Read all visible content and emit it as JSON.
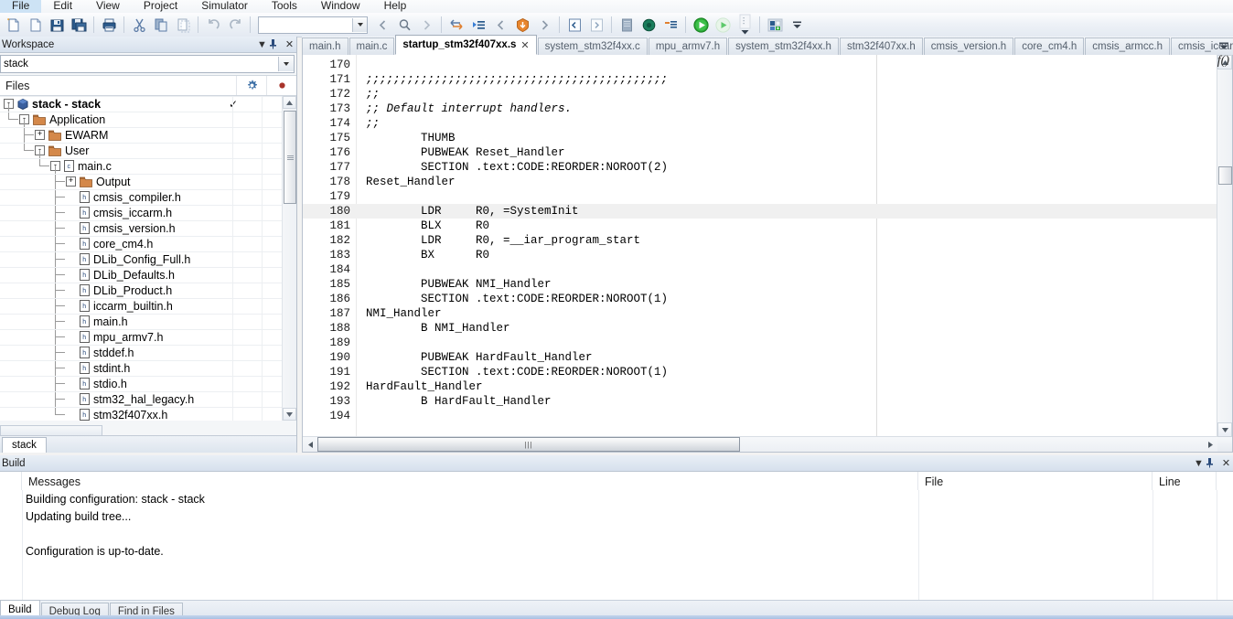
{
  "menu": {
    "items": [
      "File",
      "Edit",
      "View",
      "Project",
      "Simulator",
      "Tools",
      "Window",
      "Help"
    ]
  },
  "toolbar": {
    "buttons": [
      {
        "name": "new-document",
        "label": "New Document"
      },
      {
        "name": "open-file",
        "label": "Open File"
      },
      {
        "name": "save",
        "label": "Save"
      },
      {
        "name": "save-all",
        "label": "Save All"
      },
      {
        "name": "print",
        "label": "Print"
      },
      {
        "name": "cut",
        "label": "Cut"
      },
      {
        "name": "copy",
        "label": "Copy"
      },
      {
        "name": "paste",
        "label": "Paste"
      },
      {
        "name": "undo",
        "label": "Undo"
      },
      {
        "name": "redo",
        "label": "Redo"
      }
    ],
    "search_value": "",
    "search_placeholder": "",
    "nav_buttons": [
      {
        "name": "navigate-backward",
        "label": "Navigate Backward"
      },
      {
        "name": "quick-search",
        "label": "Quick Search"
      },
      {
        "name": "navigate-forward",
        "label": "Navigate Forward"
      },
      {
        "name": "toggle-bookmark",
        "label": "Toggle Bookmark"
      },
      {
        "name": "go-to-bookmark",
        "label": "Go To Bookmark"
      },
      {
        "name": "previous-bookmark",
        "label": "Previous Bookmark"
      },
      {
        "name": "compile",
        "label": "Compile"
      },
      {
        "name": "next-bookmark",
        "label": "Next Bookmark"
      },
      {
        "name": "step-into-source",
        "label": "Step Into"
      },
      {
        "name": "step-over-source",
        "label": "Step Over"
      },
      {
        "name": "make",
        "label": "Make"
      },
      {
        "name": "stop-build",
        "label": "Stop Build"
      },
      {
        "name": "toggle-breakpoint",
        "label": "Toggle Breakpoint"
      },
      {
        "name": "download-and-debug",
        "label": "Download and Debug"
      },
      {
        "name": "debug-without-download",
        "label": "Debug without Downloading"
      },
      {
        "name": "build-drop",
        "label": "Build Options"
      },
      {
        "name": "flash-programmer",
        "label": "Flash Programmer"
      }
    ]
  },
  "workspace": {
    "title": "Workspace",
    "controls": {
      "menu": "▼",
      "pin": "⌶",
      "close": "✕"
    },
    "config_value": "stack",
    "files_header": "Files",
    "gear_icon": "gear-icon",
    "dot_icon": "status-dot-icon",
    "bottom_tab": "stack",
    "tree": [
      {
        "label": "stack - stack",
        "depth": 0,
        "icon": "project-cube",
        "expander": "-",
        "bold": true,
        "check": "✓"
      },
      {
        "label": "Application",
        "depth": 1,
        "icon": "folder",
        "expander": "-",
        "bold": false,
        "check": ""
      },
      {
        "label": "EWARM",
        "depth": 2,
        "icon": "folder",
        "expander": "+",
        "bold": false,
        "check": ""
      },
      {
        "label": "User",
        "depth": 2,
        "icon": "folder",
        "expander": "-",
        "bold": false,
        "check": ""
      },
      {
        "label": "main.c",
        "depth": 3,
        "icon": "c-file",
        "expander": "-",
        "bold": false,
        "check": ""
      },
      {
        "label": "Output",
        "depth": 4,
        "icon": "folder",
        "expander": "+",
        "bold": false,
        "check": ""
      },
      {
        "label": "cmsis_compiler.h",
        "depth": 4,
        "icon": "h-file",
        "expander": "",
        "bold": false,
        "check": ""
      },
      {
        "label": "cmsis_iccarm.h",
        "depth": 4,
        "icon": "h-file",
        "expander": "",
        "bold": false,
        "check": ""
      },
      {
        "label": "cmsis_version.h",
        "depth": 4,
        "icon": "h-file",
        "expander": "",
        "bold": false,
        "check": ""
      },
      {
        "label": "core_cm4.h",
        "depth": 4,
        "icon": "h-file",
        "expander": "",
        "bold": false,
        "check": ""
      },
      {
        "label": "DLib_Config_Full.h",
        "depth": 4,
        "icon": "h-file",
        "expander": "",
        "bold": false,
        "check": ""
      },
      {
        "label": "DLib_Defaults.h",
        "depth": 4,
        "icon": "h-file",
        "expander": "",
        "bold": false,
        "check": ""
      },
      {
        "label": "DLib_Product.h",
        "depth": 4,
        "icon": "h-file",
        "expander": "",
        "bold": false,
        "check": ""
      },
      {
        "label": "iccarm_builtin.h",
        "depth": 4,
        "icon": "h-file",
        "expander": "",
        "bold": false,
        "check": ""
      },
      {
        "label": "main.h",
        "depth": 4,
        "icon": "h-file",
        "expander": "",
        "bold": false,
        "check": ""
      },
      {
        "label": "mpu_armv7.h",
        "depth": 4,
        "icon": "h-file",
        "expander": "",
        "bold": false,
        "check": ""
      },
      {
        "label": "stddef.h",
        "depth": 4,
        "icon": "h-file",
        "expander": "",
        "bold": false,
        "check": ""
      },
      {
        "label": "stdint.h",
        "depth": 4,
        "icon": "h-file",
        "expander": "",
        "bold": false,
        "check": ""
      },
      {
        "label": "stdio.h",
        "depth": 4,
        "icon": "h-file",
        "expander": "",
        "bold": false,
        "check": ""
      },
      {
        "label": "stm32_hal_legacy.h",
        "depth": 4,
        "icon": "h-file",
        "expander": "",
        "bold": false,
        "check": ""
      },
      {
        "label": "stm32f407xx.h",
        "depth": 4,
        "icon": "h-file",
        "expander": "",
        "bold": false,
        "check": ""
      }
    ]
  },
  "editor": {
    "tabs": [
      {
        "label": "main.h",
        "active": false,
        "closable": false
      },
      {
        "label": "main.c",
        "active": false,
        "closable": false
      },
      {
        "label": "startup_stm32f407xx.s",
        "active": true,
        "closable": true,
        "close_glyph": "✕"
      },
      {
        "label": "system_stm32f4xx.c",
        "active": false,
        "closable": false
      },
      {
        "label": "mpu_armv7.h",
        "active": false,
        "closable": false
      },
      {
        "label": "system_stm32f4xx.h",
        "active": false,
        "closable": false
      },
      {
        "label": "stm32f407xx.h",
        "active": false,
        "closable": false
      },
      {
        "label": "cmsis_version.h",
        "active": false,
        "closable": false
      },
      {
        "label": "core_cm4.h",
        "active": false,
        "closable": false
      },
      {
        "label": "cmsis_armcc.h",
        "active": false,
        "closable": false
      },
      {
        "label": "cmsis_iccarm.h",
        "active": false,
        "closable": false
      }
    ],
    "overflow_glyph": "⍖",
    "function_nav_label": "f()",
    "current_line": 180,
    "lines": [
      {
        "num": 170,
        "text": "",
        "comment": false
      },
      {
        "num": 171,
        "text": ";;;;;;;;;;;;;;;;;;;;;;;;;;;;;;;;;;;;;;;;;;;;",
        "comment": true
      },
      {
        "num": 172,
        "text": ";;",
        "comment": true
      },
      {
        "num": 173,
        "text": ";; Default interrupt handlers.",
        "comment": true
      },
      {
        "num": 174,
        "text": ";;",
        "comment": true
      },
      {
        "num": 175,
        "text": "        THUMB",
        "comment": false
      },
      {
        "num": 176,
        "text": "        PUBWEAK Reset_Handler",
        "comment": false
      },
      {
        "num": 177,
        "text": "        SECTION .text:CODE:REORDER:NOROOT(2)",
        "comment": false
      },
      {
        "num": 178,
        "text": "Reset_Handler",
        "comment": false
      },
      {
        "num": 179,
        "text": "",
        "comment": false
      },
      {
        "num": 180,
        "text": "        LDR     R0, =SystemInit",
        "comment": false
      },
      {
        "num": 181,
        "text": "        BLX     R0",
        "comment": false
      },
      {
        "num": 182,
        "text": "        LDR     R0, =__iar_program_start",
        "comment": false
      },
      {
        "num": 183,
        "text": "        BX      R0",
        "comment": false
      },
      {
        "num": 184,
        "text": "",
        "comment": false
      },
      {
        "num": 185,
        "text": "        PUBWEAK NMI_Handler",
        "comment": false
      },
      {
        "num": 186,
        "text": "        SECTION .text:CODE:REORDER:NOROOT(1)",
        "comment": false
      },
      {
        "num": 187,
        "text": "NMI_Handler",
        "comment": false
      },
      {
        "num": 188,
        "text": "        B NMI_Handler",
        "comment": false
      },
      {
        "num": 189,
        "text": "",
        "comment": false
      },
      {
        "num": 190,
        "text": "        PUBWEAK HardFault_Handler",
        "comment": false
      },
      {
        "num": 191,
        "text": "        SECTION .text:CODE:REORDER:NOROOT(1)",
        "comment": false
      },
      {
        "num": 192,
        "text": "HardFault_Handler",
        "comment": false
      },
      {
        "num": 193,
        "text": "        B HardFault_Handler",
        "comment": false
      },
      {
        "num": 194,
        "text": "",
        "comment": false
      }
    ]
  },
  "build": {
    "title": "Build",
    "controls": {
      "menu": "▼",
      "pin": "⌶",
      "close": "✕"
    },
    "columns": [
      "Messages",
      "File",
      "Line"
    ],
    "messages": [
      "Building configuration: stack - stack",
      "Updating build tree...",
      "",
      "Configuration is up-to-date."
    ]
  },
  "bottom_tabs": [
    {
      "label": "Build",
      "active": true
    },
    {
      "label": "Debug Log",
      "active": false
    },
    {
      "label": "Find in Files",
      "active": false
    }
  ],
  "colors": {
    "comment_blue": "#2a3fa8",
    "folder_orange": "#d4884a",
    "accent_blue": "#2a4b7c",
    "run_green": "#22aa22",
    "shield_orange": "#e08030"
  }
}
